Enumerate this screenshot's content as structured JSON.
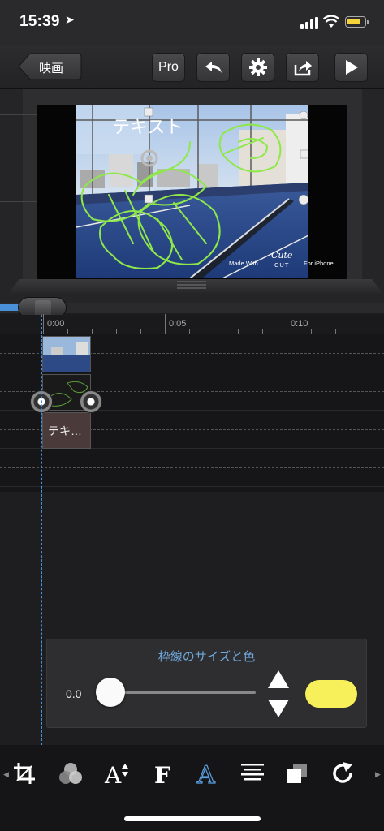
{
  "status_bar": {
    "time": "15:39",
    "location_glyph": "➤"
  },
  "toolbar": {
    "back_label": "映画",
    "pro_label": "Pro"
  },
  "preview": {
    "overlay_text": "テキスト",
    "watermark_made": "Made With",
    "watermark_cute": "Cute",
    "watermark_cut": "CUT",
    "watermark_for": "For iPhone"
  },
  "timeline": {
    "ticks": [
      "0:00",
      "0:05",
      "0:10"
    ],
    "text_clip_label": "テキ…"
  },
  "panel": {
    "title": "枠線のサイズと色",
    "value": "0.0",
    "slider_fraction": 0.0,
    "color": "#f7f05a"
  },
  "colors": {
    "accent": "#4a90d9",
    "panel_title": "#6fa8dc",
    "drawing": "#8ee84a",
    "battery": "#f5d33a"
  },
  "bottom_tools": [
    "crop-icon",
    "color-filter-icon",
    "font-size-icon",
    "font-icon",
    "text-style-icon",
    "align-icon",
    "layer-icon",
    "redo-icon"
  ]
}
